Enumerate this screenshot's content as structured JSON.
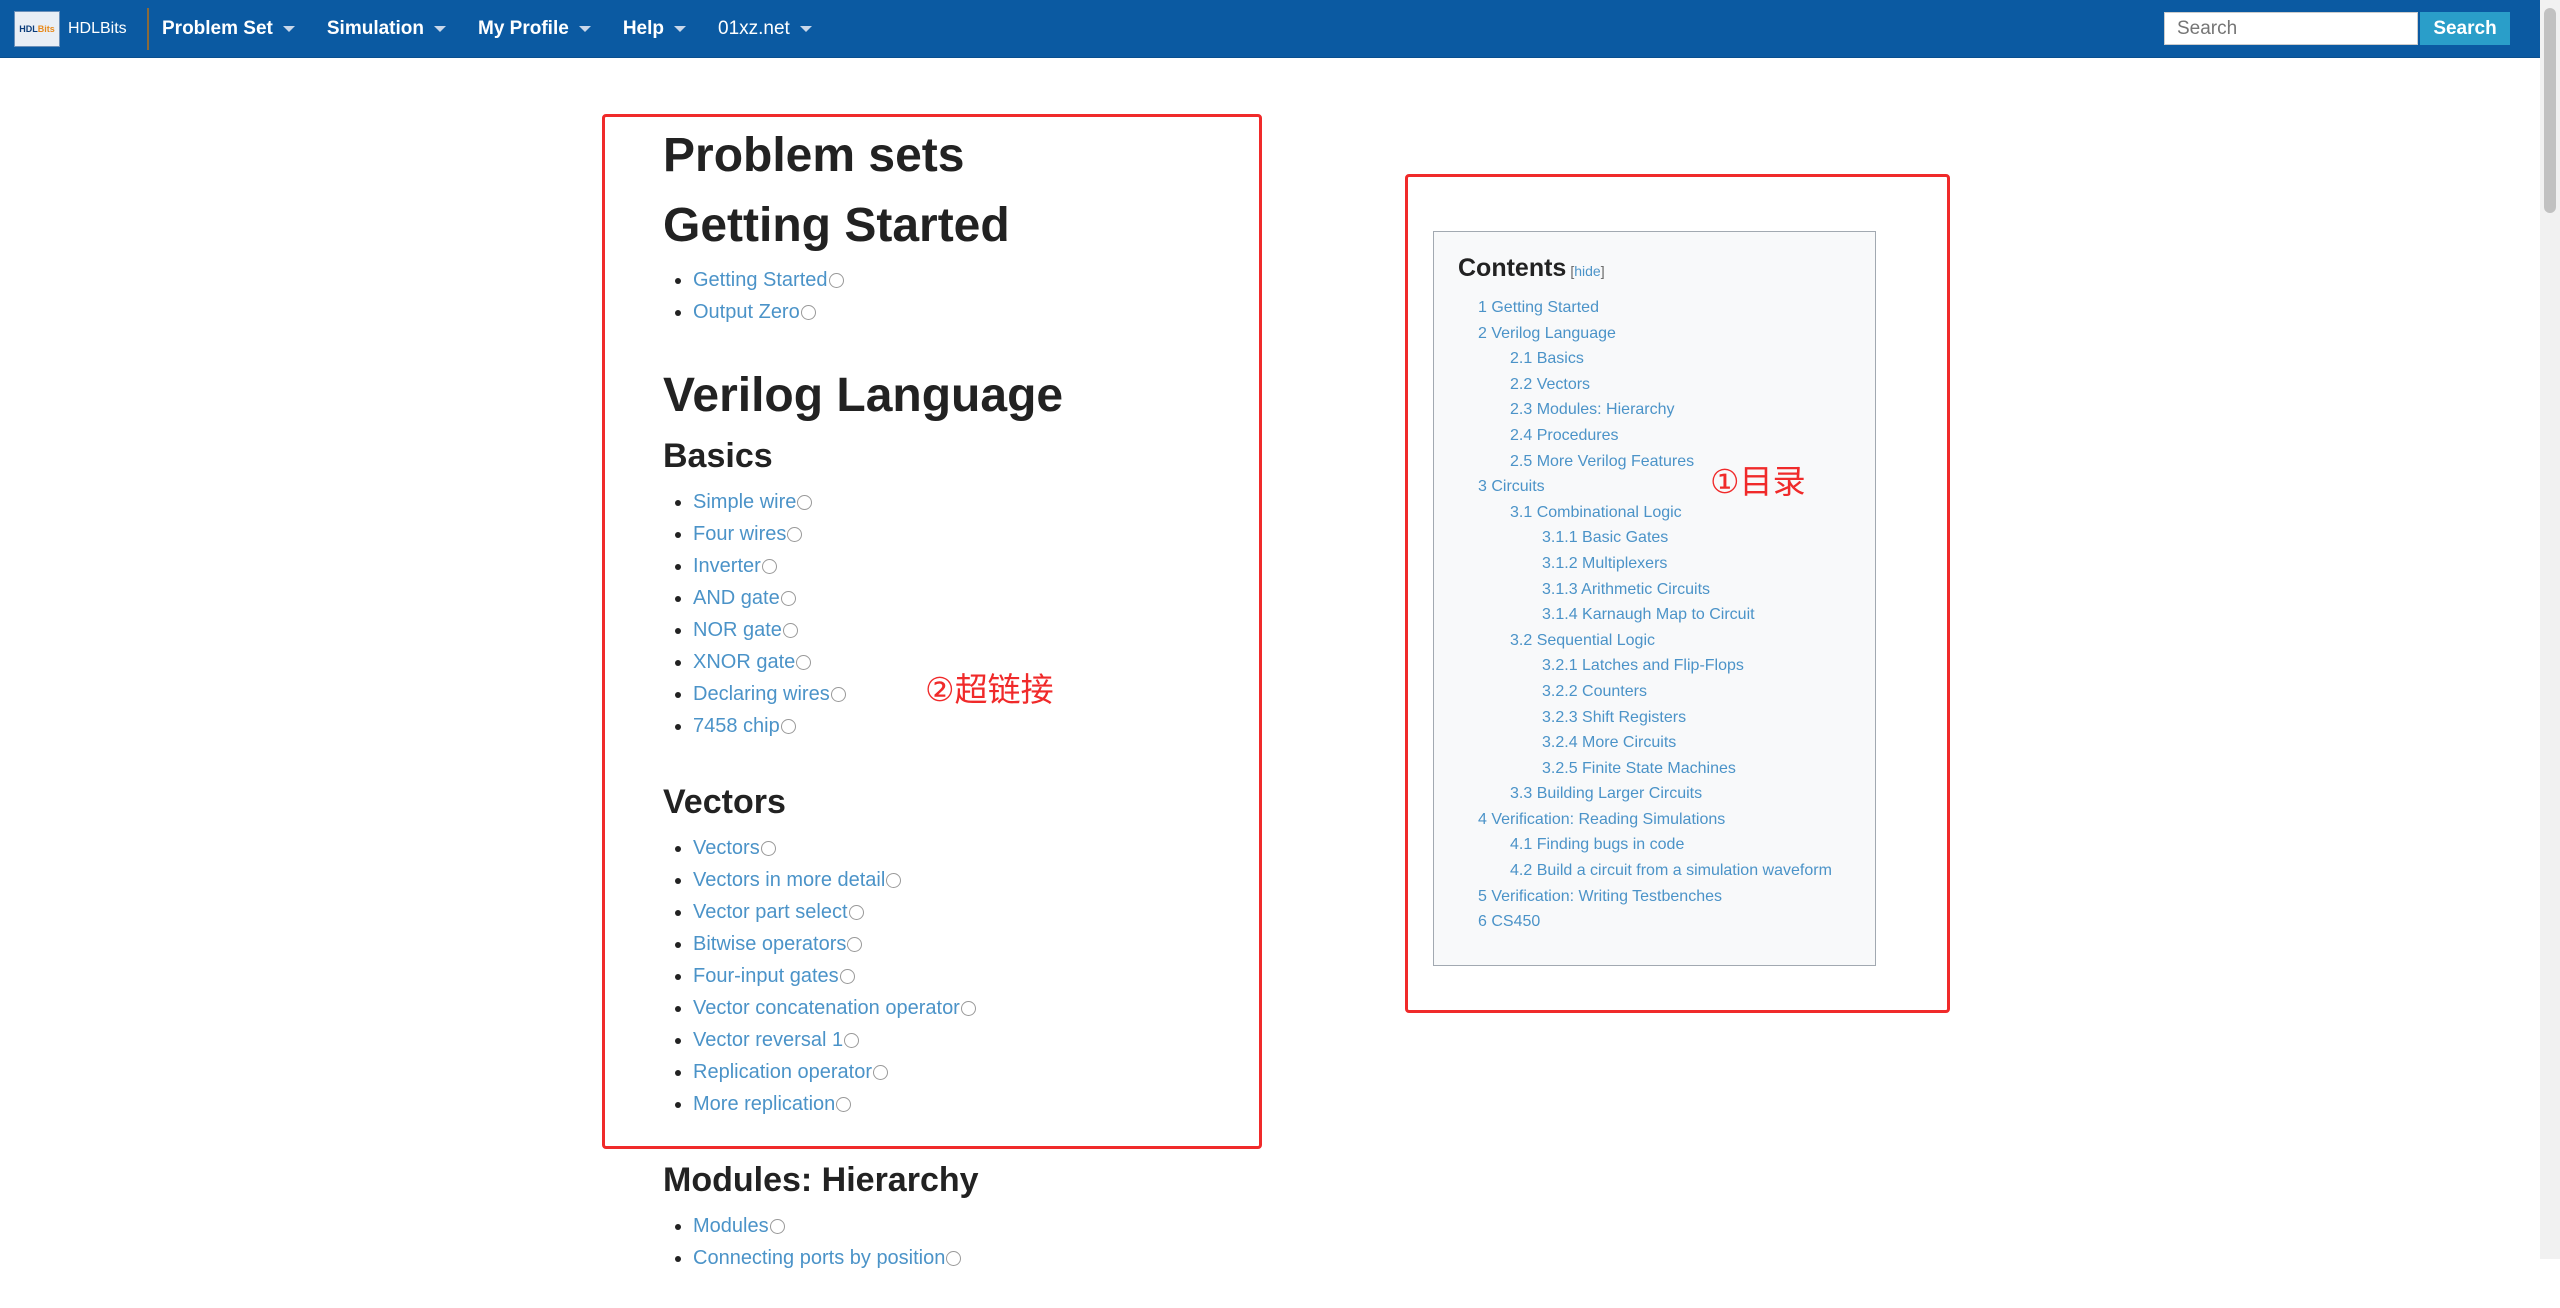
{
  "navbar": {
    "brand": "HDLBits",
    "logo_text_a": "HDL",
    "logo_text_b": "Bits",
    "menu": [
      {
        "label": "Problem Set"
      },
      {
        "label": "Simulation"
      },
      {
        "label": "My Profile"
      },
      {
        "label": "Help"
      },
      {
        "label": "01xz.net"
      }
    ],
    "search_placeholder": "Search",
    "search_button": "Search"
  },
  "main": {
    "page_title": "Problem sets",
    "getting_started": {
      "title": "Getting Started",
      "items": [
        "Getting Started",
        "Output Zero"
      ]
    },
    "verilog_language": {
      "title": "Verilog Language",
      "basics": {
        "title": "Basics",
        "items": [
          "Simple wire",
          "Four wires",
          "Inverter",
          "AND gate",
          "NOR gate",
          "XNOR gate",
          "Declaring wires",
          "7458 chip"
        ]
      },
      "vectors": {
        "title": "Vectors",
        "items": [
          "Vectors",
          "Vectors in more detail",
          "Vector part select",
          "Bitwise operators",
          "Four-input gates",
          "Vector concatenation operator",
          "Vector reversal 1",
          "Replication operator",
          "More replication"
        ]
      },
      "modules": {
        "title": "Modules: Hierarchy",
        "items": [
          "Modules",
          "Connecting ports by position"
        ]
      }
    }
  },
  "toc": {
    "title": "Contents",
    "hide_open": "[",
    "hide_label": "hide",
    "hide_close": "]",
    "entries": [
      {
        "text": "1 Getting Started",
        "level": 1
      },
      {
        "text": "2 Verilog Language",
        "level": 1
      },
      {
        "text": "2.1 Basics",
        "level": 2
      },
      {
        "text": "2.2 Vectors",
        "level": 2
      },
      {
        "text": "2.3 Modules: Hierarchy",
        "level": 2
      },
      {
        "text": "2.4 Procedures",
        "level": 2
      },
      {
        "text": "2.5 More Verilog Features",
        "level": 2
      },
      {
        "text": "3 Circuits",
        "level": 1
      },
      {
        "text": "3.1 Combinational Logic",
        "level": 2
      },
      {
        "text": "3.1.1 Basic Gates",
        "level": 3
      },
      {
        "text": "3.1.2 Multiplexers",
        "level": 3
      },
      {
        "text": "3.1.3 Arithmetic Circuits",
        "level": 3
      },
      {
        "text": "3.1.4 Karnaugh Map to Circuit",
        "level": 3
      },
      {
        "text": "3.2 Sequential Logic",
        "level": 2
      },
      {
        "text": "3.2.1 Latches and Flip-Flops",
        "level": 3
      },
      {
        "text": "3.2.2 Counters",
        "level": 3
      },
      {
        "text": "3.2.3 Shift Registers",
        "level": 3
      },
      {
        "text": "3.2.4 More Circuits",
        "level": 3
      },
      {
        "text": "3.2.5 Finite State Machines",
        "level": 3
      },
      {
        "text": "3.3 Building Larger Circuits",
        "level": 2
      },
      {
        "text": "4 Verification: Reading Simulations",
        "level": 1
      },
      {
        "text": "4.1 Finding bugs in code",
        "level": 2
      },
      {
        "text": "4.2 Build a circuit from a simulation waveform",
        "level": 2
      },
      {
        "text": "5 Verification: Writing Testbenches",
        "level": 1
      },
      {
        "text": "6 CS450",
        "level": 1
      }
    ]
  },
  "annotations": {
    "toc_label": "①目录",
    "links_label": "②超链接"
  },
  "colors": {
    "navbar": "#0b5aa2",
    "link": "#4b93c8",
    "annotation": "#f02a2a",
    "search_button": "#2a9ec9"
  }
}
